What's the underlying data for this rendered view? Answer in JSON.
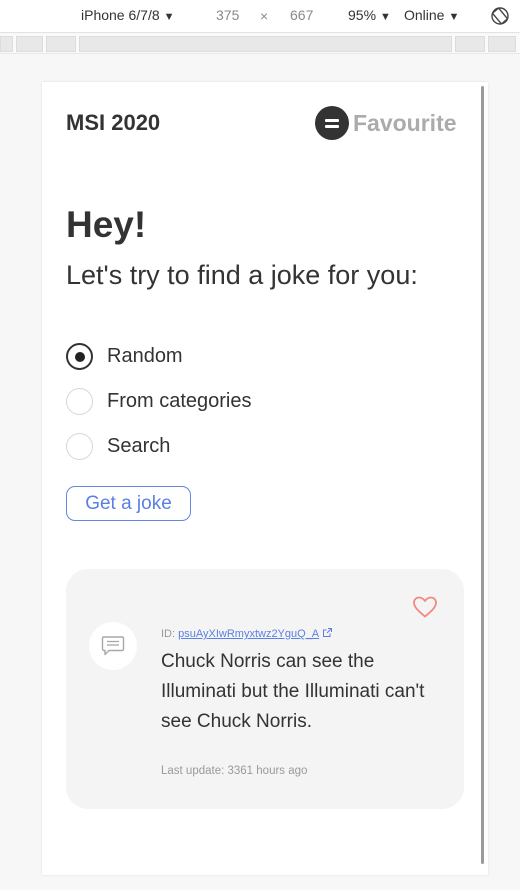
{
  "devtools": {
    "device": "iPhone 6/7/8",
    "width": "375",
    "times": "×",
    "height": "667",
    "zoom": "95%",
    "network": "Online",
    "caret": "▼"
  },
  "header": {
    "title": "MSI 2020",
    "favourite_label": "Favourite"
  },
  "hero": {
    "heading": "Hey!",
    "subtitle": "Let's try to find a joke for you:"
  },
  "options": [
    {
      "label": "Random",
      "checked": true
    },
    {
      "label": "From categories",
      "checked": false
    },
    {
      "label": "Search",
      "checked": false
    }
  ],
  "get_joke_label": "Get a joke",
  "joke": {
    "id_prefix": "ID:",
    "id": "psuAyXIwRmyxtwz2YguQ_A",
    "text": "Chuck Norris can see the Illuminati but the Illuminati can't see Chuck Norris.",
    "last_update": "Last update: 3361 hours ago"
  },
  "colors": {
    "accent": "#5b80e3",
    "heart": "#f08a80",
    "card_bg": "#f4f4f4",
    "text": "#333333",
    "muted": "#ababab"
  }
}
